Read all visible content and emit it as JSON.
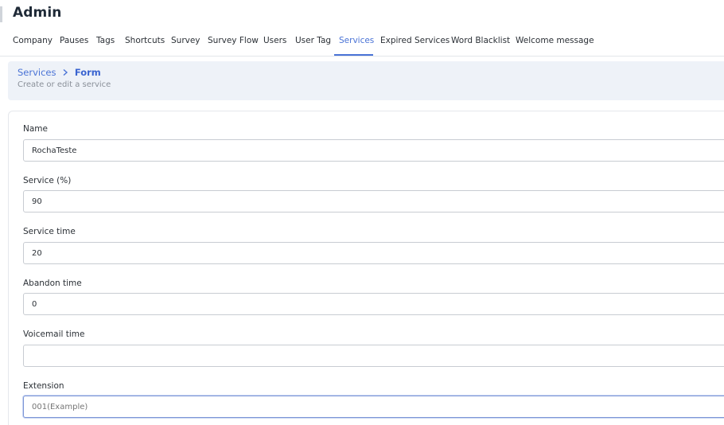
{
  "app": {
    "title": "Admin"
  },
  "tabs": [
    {
      "label": "Company"
    },
    {
      "label": "Pauses"
    },
    {
      "label": "Tags"
    },
    {
      "label": "Shortcuts"
    },
    {
      "label": "Survey"
    },
    {
      "label": "Survey Flow"
    },
    {
      "label": "Users"
    },
    {
      "label": "User Tag"
    },
    {
      "label": "Services",
      "active": true
    },
    {
      "label": "Expired Services"
    },
    {
      "label": "Word Blacklist"
    },
    {
      "label": "Welcome message"
    }
  ],
  "header": {
    "breadcrumb_parent": "Services",
    "breadcrumb_current": "Form",
    "subtitle": "Create or edit a service"
  },
  "form": {
    "name": {
      "label": "Name",
      "value": "RochaTeste"
    },
    "service_pct": {
      "label": "Service (%)",
      "value": "90"
    },
    "service_time": {
      "label": "Service time",
      "value": "20"
    },
    "abandon_time": {
      "label": "Abandon time",
      "value": "0"
    },
    "voicemail_time": {
      "label": "Voicemail time",
      "value": ""
    },
    "extension": {
      "label": "Extension",
      "placeholder": "001(Example)",
      "value": ""
    }
  },
  "colors": {
    "accent": "#4a73d6",
    "header_bg": "#eef2f8"
  }
}
